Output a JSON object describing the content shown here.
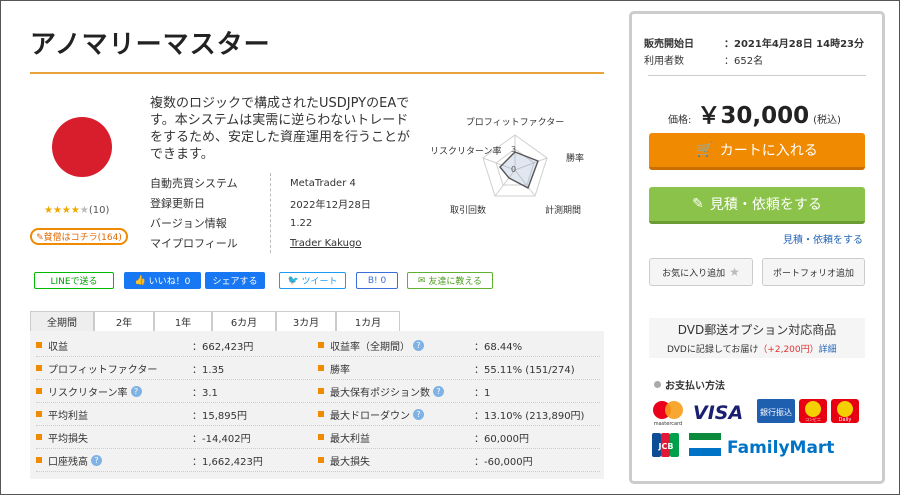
{
  "product": {
    "title": "アノマリーマスター",
    "description": "複数のロジックで構成されたUSDJPYのEAです。本システムは実需に逆らわないトレードをするため、安定した資産運用を行うことができます。",
    "rating_value": 4,
    "rating_count": "(10)",
    "review_button": "✎貧僧はコチラ(164)",
    "info": [
      {
        "label": "自動売買システム",
        "value": "MetaTrader 4"
      },
      {
        "label": "登録更新日",
        "value": "2022年12月28日"
      },
      {
        "label": "バージョン情報",
        "value": "1.22"
      },
      {
        "label": "マイプロフィール",
        "value": "Trader Kakugo"
      }
    ]
  },
  "radar": {
    "labels": {
      "top": "プロフィットファクター",
      "right": "勝率",
      "bottom_right": "計測期間",
      "bottom_left": "取引回数",
      "left": "リスクリターン率"
    },
    "tick_3": "3",
    "tick_0": "0"
  },
  "share": {
    "line": "LINEで送る",
    "like": "いいね！0",
    "share": "シェアする",
    "tweet": "ツイート",
    "hatena": "B! 0",
    "mail": "友達に教える"
  },
  "tabs": [
    "全期間",
    "2年",
    "1年",
    "6カ月",
    "3カ月",
    "1カ月"
  ],
  "stats": [
    [
      {
        "label": "収益",
        "value": "：662,423円",
        "help": false
      },
      {
        "label": "収益率（全期間）",
        "value": "：68.44%",
        "help": true
      }
    ],
    [
      {
        "label": "プロフィットファクター",
        "value": "：1.35",
        "help": false
      },
      {
        "label": "勝率",
        "value": "：55.11% (151/274)",
        "help": false
      }
    ],
    [
      {
        "label": "リスクリターン率",
        "value": "：3.1",
        "help": true
      },
      {
        "label": "最大保有ポジション数",
        "value": "：1",
        "help": true
      }
    ],
    [
      {
        "label": "平均利益",
        "value": "：15,895円",
        "help": false
      },
      {
        "label": "最大ドローダウン",
        "value": "：13.10% (213,890円)",
        "help": true
      }
    ],
    [
      {
        "label": "平均損失",
        "value": "：-14,402円",
        "help": false
      },
      {
        "label": "最大利益",
        "value": "：60,000円",
        "help": false
      }
    ],
    [
      {
        "label": "口座残高",
        "value": "：1,662,423円",
        "help": true
      },
      {
        "label": "最大損失",
        "value": "：-60,000円",
        "help": false
      }
    ]
  ],
  "panel": {
    "sale_start_label": "販売開始日",
    "sale_start_value": "：2021年4月28日 14時23分",
    "users_label": "利用者数",
    "users_value": "：652名",
    "price_label": "価格:",
    "price": "￥30,000",
    "tax": "(税込)",
    "cart_button": "カートに入れる",
    "quote_button": "見積・依頼をする",
    "quote_link": "見積・依頼をする",
    "favorite_button": "お気に入り追加",
    "portfolio_button": "ポートフォリオ追加",
    "dvd_title": "DVD郵送オプション対応商品",
    "dvd_text": "DVDに記録してお届け",
    "dvd_price": "（+2,200円）",
    "dvd_link": "詳細",
    "payment_title": "お支払い方法",
    "payment_logos": [
      "mastercard",
      "VISA",
      "銀行振込",
      "コンビニ",
      "Daily",
      "JCB",
      "FamilyMart"
    ]
  },
  "colors": {
    "accent_orange": "#f08a00",
    "green": "#8bc34a",
    "link_blue": "#2566b8",
    "flag_red": "#d81e2c"
  }
}
